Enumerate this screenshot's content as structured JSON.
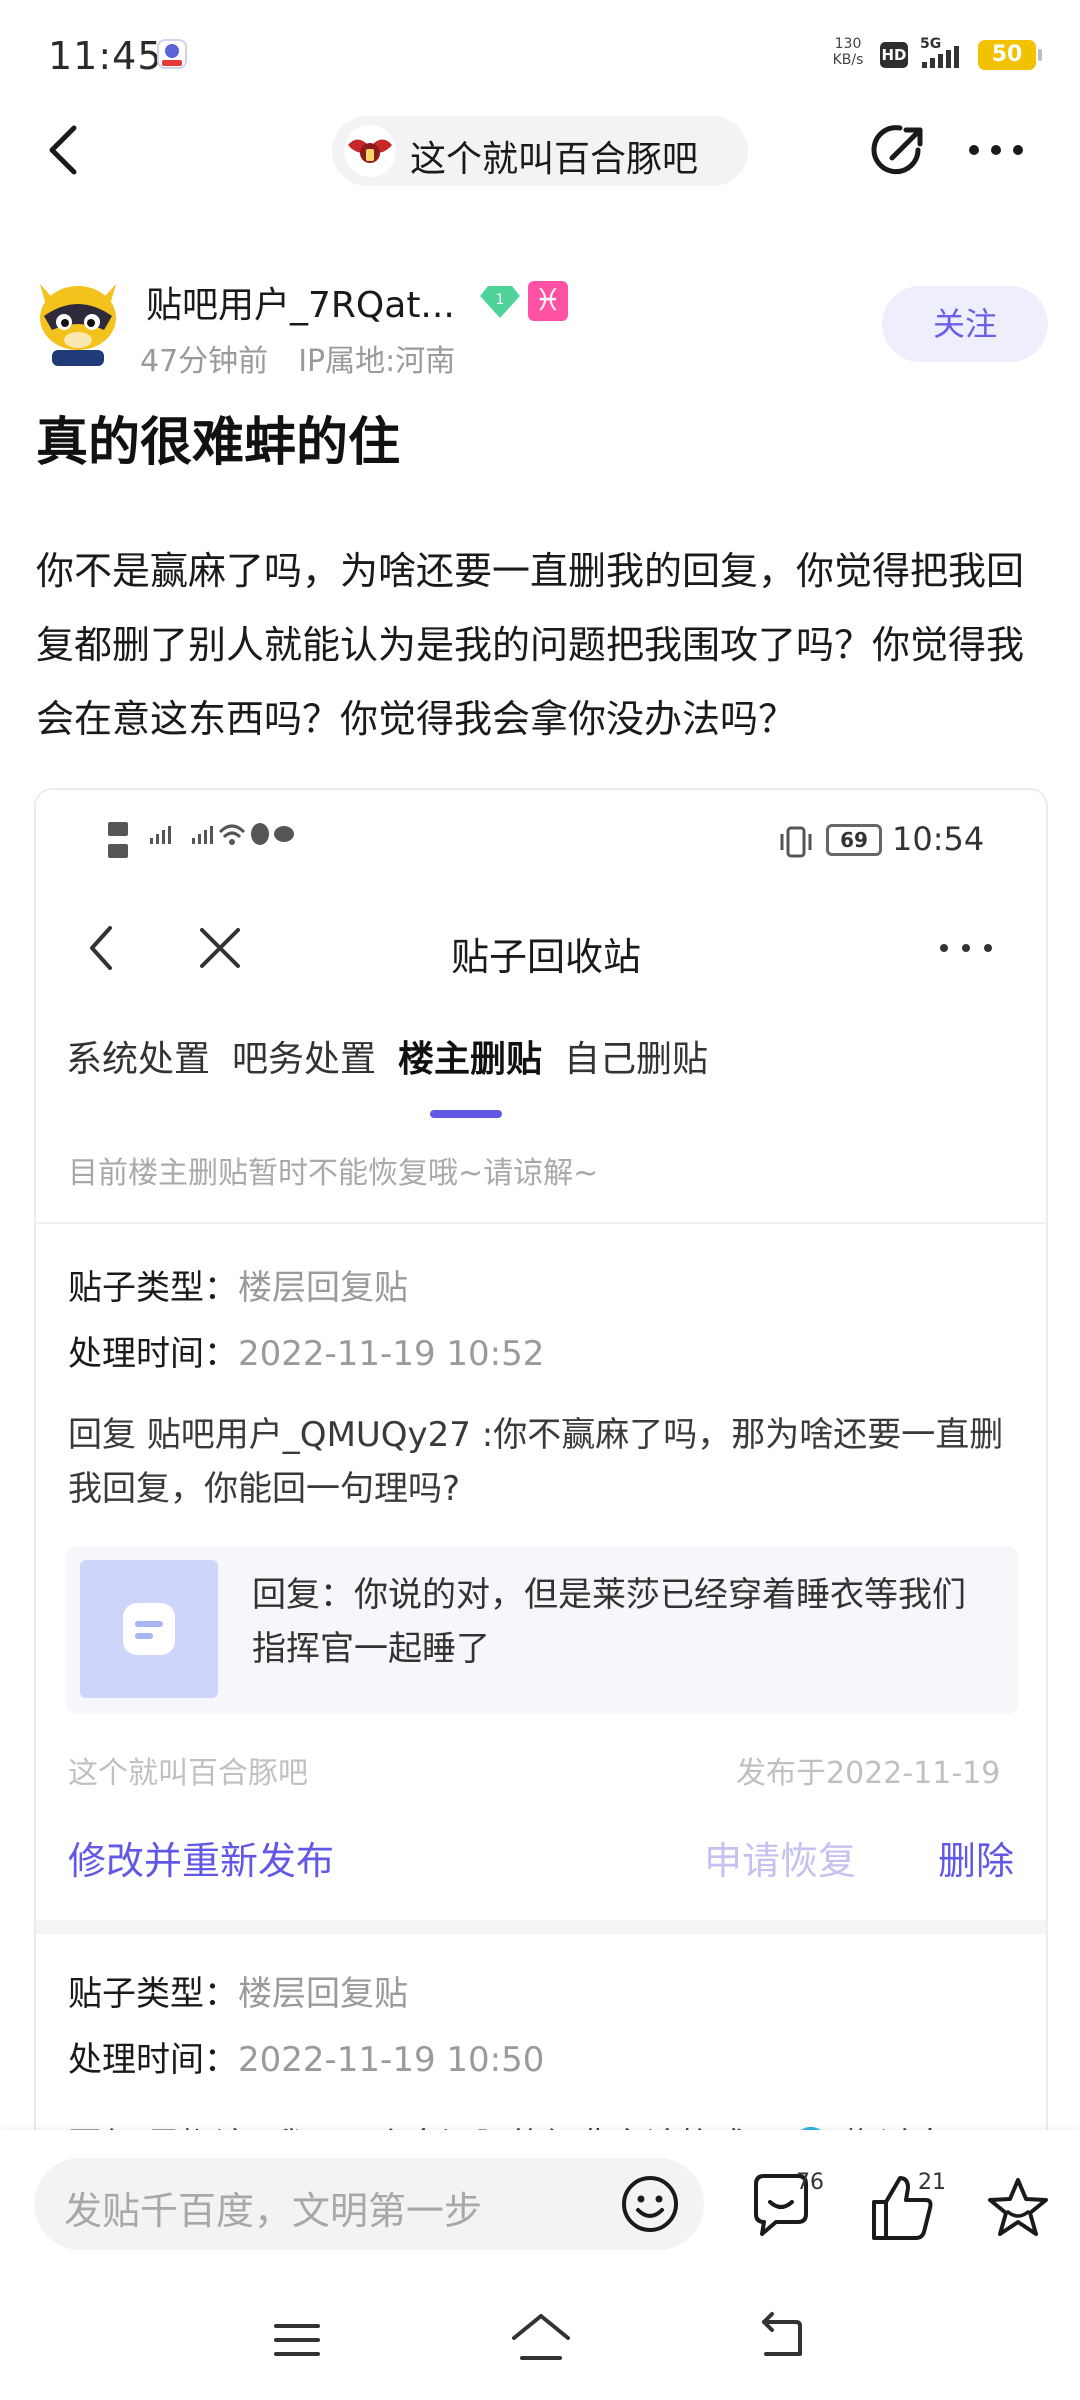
{
  "status_bar": {
    "time": "11:45",
    "net_speed_value": "130",
    "net_speed_unit": "KB/s",
    "hd": "HD",
    "network": "5G",
    "battery": "50"
  },
  "header": {
    "forum_name": "这个就叫百合豚吧"
  },
  "author": {
    "name": "贴吧用户_7RQat...",
    "level": "1",
    "sign": "♓",
    "time_ago": "47分钟前",
    "ip_location": "IP属地:河南",
    "follow_label": "关注"
  },
  "post": {
    "title": "真的很难蚌的住",
    "body": "你不是赢麻了吗，为啥还要一直删我的回复，你觉得把我回复都删了别人就能认为是我的问题把我围攻了吗？你觉得我会在意这东西吗？你觉得我会拿你没办法吗？"
  },
  "screenshot": {
    "battery": "69",
    "time": "10:54",
    "title": "贴子回收站",
    "tabs": [
      "系统处置",
      "吧务处置",
      "楼主删贴",
      "自己删贴"
    ],
    "active_tab": 2,
    "notice": "目前楼主删贴暂时不能恢复哦~请谅解~",
    "items": [
      {
        "type_label": "贴子类型：",
        "type_value": "楼层回复贴",
        "time_label": "处理时间：",
        "time_value": "2022-11-19 10:52",
        "reply": "回复 贴吧用户_QMUQy27 :你不赢麻了吗，那为啥还要一直删我回复，你能回一句理吗?",
        "quote": "回复：你说的对，但是莱莎已经穿着睡衣等我们指挥官一起睡了",
        "forum": "这个就叫百合豚吧",
        "published": "发布于2022-11-19",
        "edit_label": "修改并重新发布",
        "restore_label": "申请恢复",
        "delete_label": "删除"
      },
      {
        "type_label": "贴子类型：",
        "type_value": "楼层回复贴",
        "time_label": "处理时间：",
        "time_value": "2022-11-19 10:50",
        "reply": "回复 黑椒滚 :我用一个白河豚的经典言论格式玩 🐬 搬过来"
      }
    ]
  },
  "bottom_bar": {
    "placeholder": "发贴千百度，文明第一步",
    "reply_count": "76",
    "like_count": "21"
  },
  "colors": {
    "accent": "#6159e6",
    "follow_bg": "#efeefc",
    "battery": "#f2c200",
    "sign_badge": "#ff52a5"
  }
}
